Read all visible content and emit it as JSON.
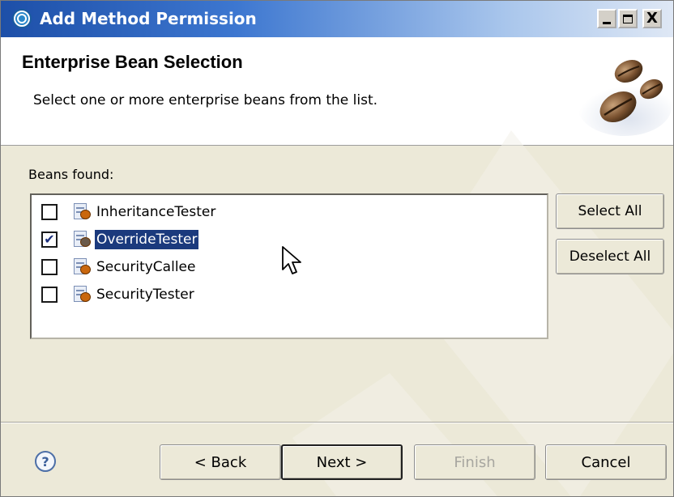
{
  "window": {
    "title": "Add Method Permission",
    "controls": {
      "minimize": "_",
      "maximize": "□",
      "close": "X"
    }
  },
  "header": {
    "title": "Enterprise Bean Selection",
    "description": "Select one or more enterprise beans from the list."
  },
  "beans": {
    "label": "Beans found:",
    "items": [
      {
        "name": "InheritanceTester",
        "checked": false,
        "selected": false
      },
      {
        "name": "OverrideTester",
        "checked": true,
        "selected": true
      },
      {
        "name": "SecurityCallee",
        "checked": false,
        "selected": false
      },
      {
        "name": "SecurityTester",
        "checked": false,
        "selected": false
      }
    ]
  },
  "side_buttons": {
    "select_all": "Select All",
    "deselect_all": "Deselect All"
  },
  "footer": {
    "help": "?",
    "back": "< Back",
    "next": "Next >",
    "finish": "Finish",
    "cancel": "Cancel"
  },
  "colors": {
    "titlebar_start": "#1d4fa8",
    "selection": "#1b3a7d",
    "window_bg": "#ece9d8",
    "bean_accent": "#c9670e"
  }
}
